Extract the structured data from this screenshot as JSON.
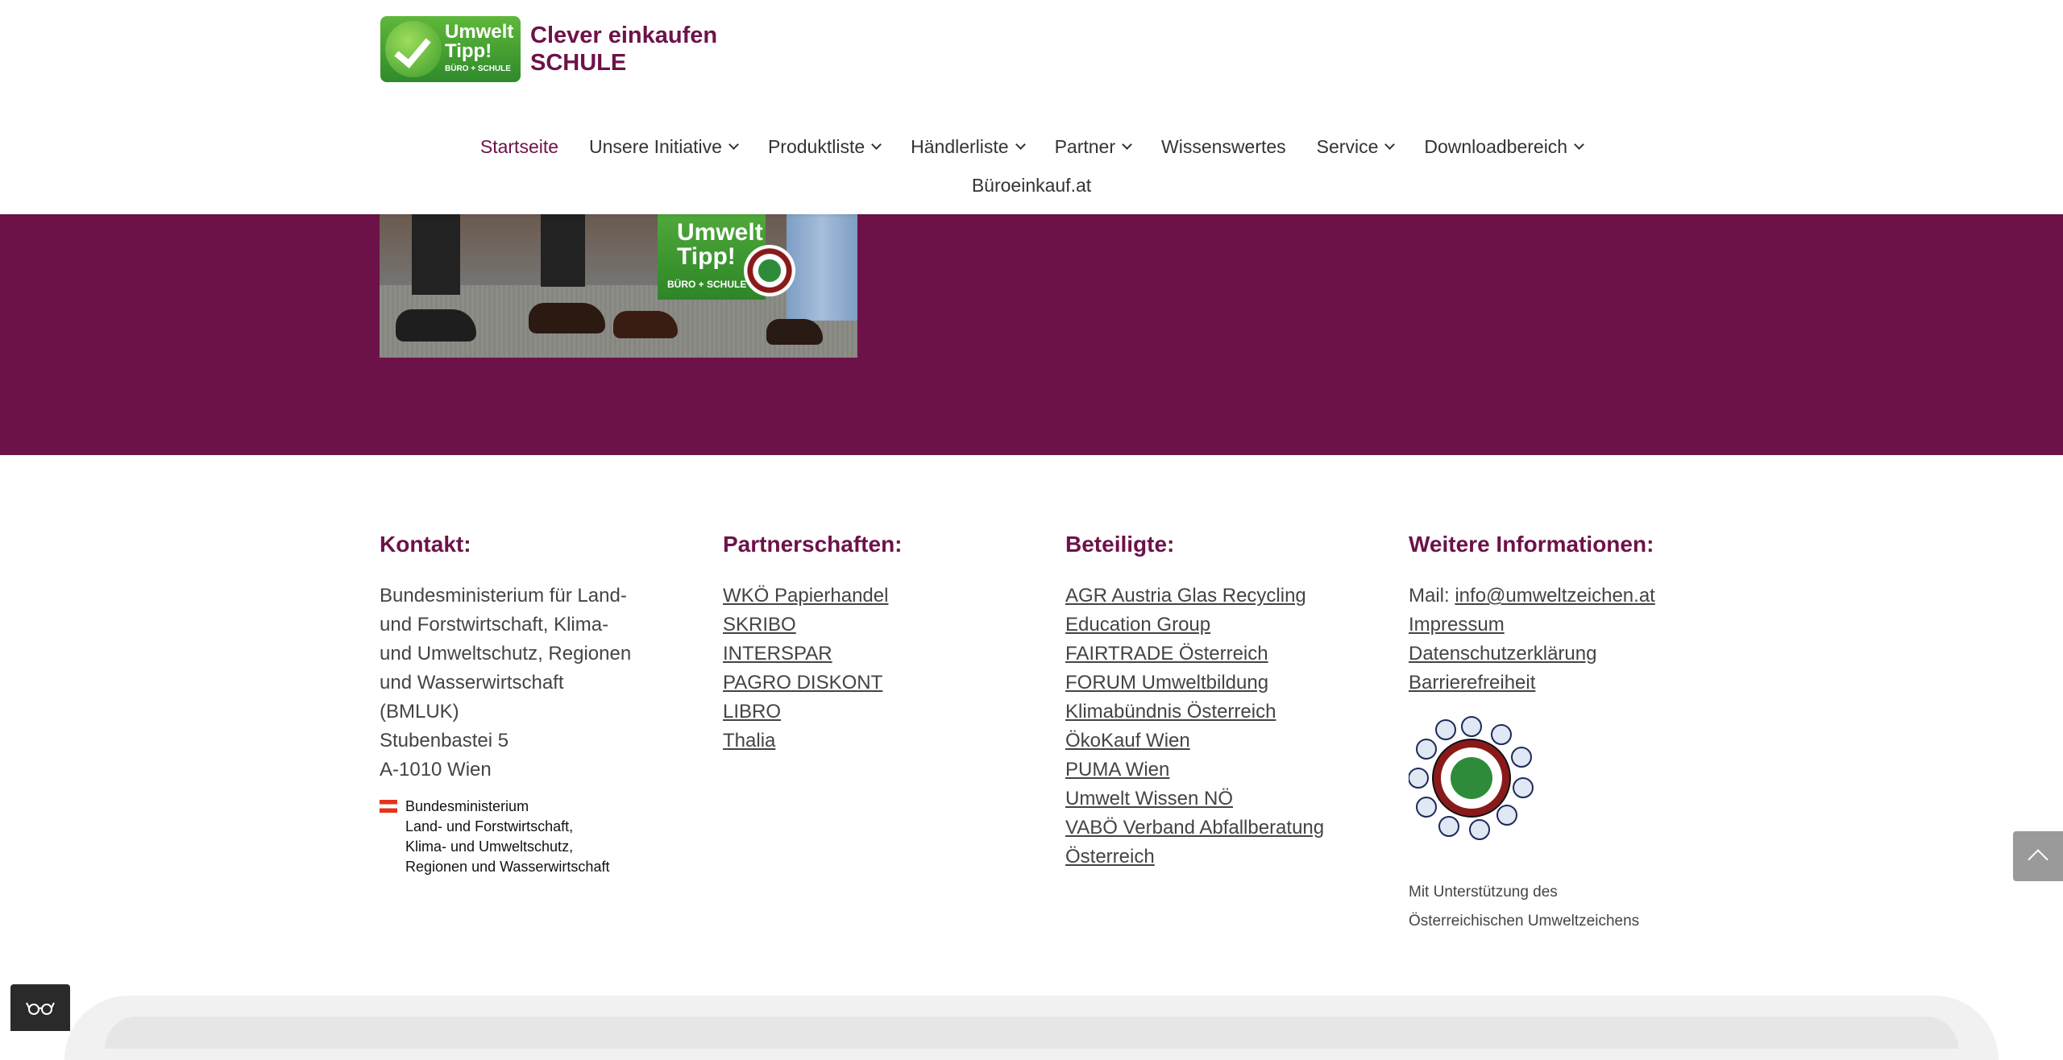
{
  "header": {
    "logo": {
      "badge_line1": "Umwelt",
      "badge_line2": "Tipp!",
      "badge_sub": "BÜRO + SCHULE",
      "title_line1": "Clever einkaufen",
      "title_line2": "SCHULE"
    },
    "nav": [
      {
        "label": "Startseite",
        "active": true,
        "has_dropdown": false
      },
      {
        "label": "Unsere Initiative",
        "active": false,
        "has_dropdown": true
      },
      {
        "label": "Produktliste",
        "active": false,
        "has_dropdown": true
      },
      {
        "label": "Händlerliste",
        "active": false,
        "has_dropdown": true
      },
      {
        "label": "Partner",
        "active": false,
        "has_dropdown": true
      },
      {
        "label": "Wissenswertes",
        "active": false,
        "has_dropdown": false
      },
      {
        "label": "Service",
        "active": false,
        "has_dropdown": true
      },
      {
        "label": "Downloadbereich",
        "active": false,
        "has_dropdown": true
      }
    ],
    "nav_row2": [
      {
        "label": "Büroeinkauf.at"
      }
    ]
  },
  "hero_image": {
    "badge_line1": "Umwelt",
    "badge_line2": "Tipp!",
    "badge_sub": "BÜRO + SCHULE"
  },
  "footer": {
    "kontakt": {
      "heading": "Kontakt:",
      "lines": [
        "Bundesministerium für Land-",
        "und Forstwirtschaft, Klima-",
        "und Umweltschutz, Regionen",
        "und Wasserwirtschaft",
        "(BMLUK)",
        "Stubenbastei 5",
        "A-1010 Wien"
      ],
      "ministry_logo_lines": [
        "Bundesministerium",
        "Land- und Forstwirtschaft,",
        "Klima- und Umweltschutz,",
        "Regionen und Wasserwirtschaft"
      ]
    },
    "partnerschaften": {
      "heading": "Partnerschaften:",
      "links": [
        "WKÖ Papierhandel",
        "SKRIBO",
        "INTERSPAR",
        "PAGRO DISKONT",
        "LIBRO",
        "Thalia"
      ]
    },
    "beteiligte": {
      "heading": "Beteiligte:",
      "links": [
        "AGR Austria Glas Recycling",
        "Education Group",
        "FAIRTRADE Österreich",
        "FORUM Umweltbildung",
        "Klimabündnis Österreich",
        "ÖkoKauf Wien",
        "PUMA Wien",
        "Umwelt Wissen NÖ",
        "VABÖ Verband Abfallberatung",
        "Österreich"
      ]
    },
    "weitere": {
      "heading": "Weitere Informationen:",
      "mail_label": "Mail: ",
      "mail_value": "info@umweltzeichen.at",
      "links": [
        "Impressum",
        "Datenschutzerklärung",
        "Barrierefreiheit"
      ],
      "support_line1": "Mit Unterstützung des",
      "support_line2": "Österreichischen Umweltzeichens"
    }
  },
  "colors": {
    "brand_purple": "#6d1249",
    "text": "#444444",
    "green": "#3b9b2c"
  },
  "icons": {
    "back_to_top": "chevron-up-icon",
    "accessibility": "glasses-icon"
  }
}
